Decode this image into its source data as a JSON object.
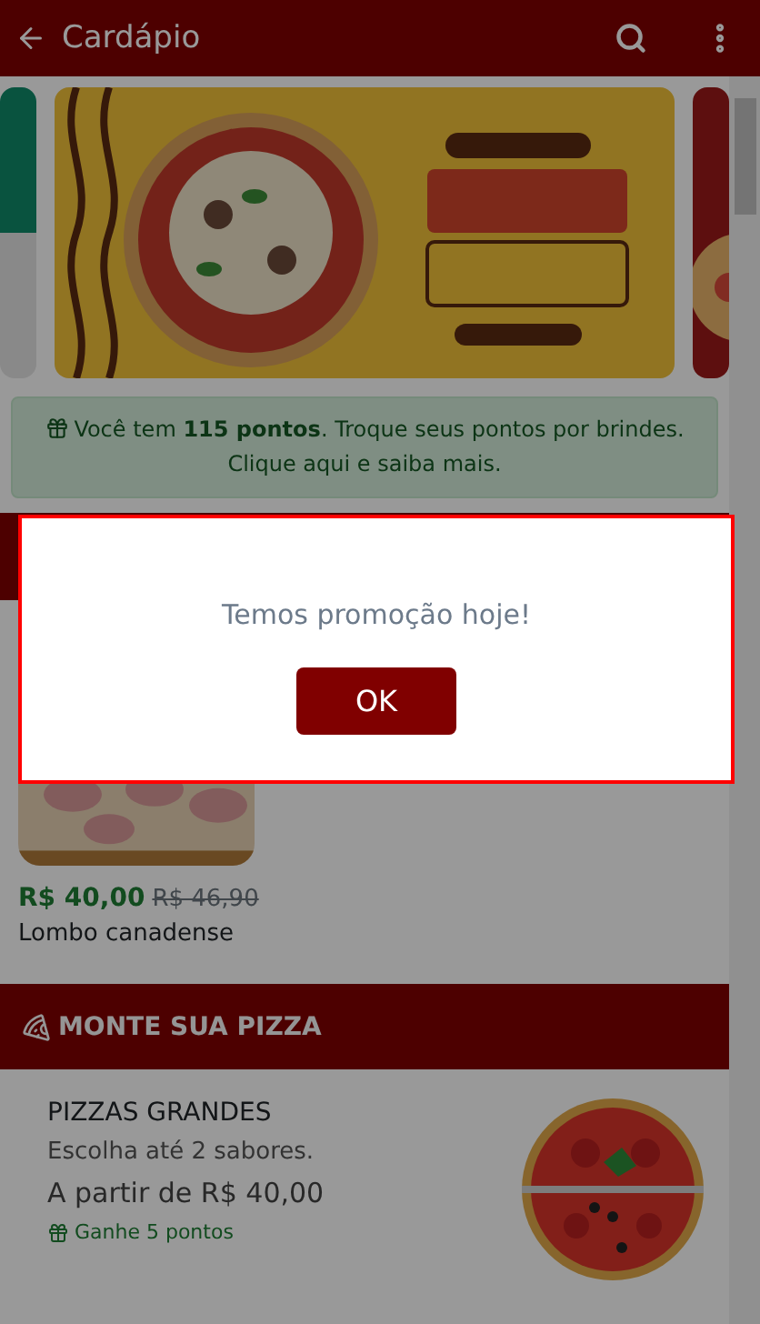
{
  "header": {
    "title": "Cardápio"
  },
  "points_notice": {
    "text": "Você tem **115 pontos**. Troque seus pontos por brindes. Clique aqui e saiba mais."
  },
  "products": [
    {
      "price": "R$ 40,00",
      "old_price": "R$ 46,90",
      "name": "Lombo canadense"
    }
  ],
  "build_section": {
    "title": "MONTE SUA PIZZA",
    "item": {
      "title": "PIZZAS GRANDES",
      "description": "Escolha até 2 sabores.",
      "price": "A partir de R$ 40,00",
      "points": "Ganhe 5 pontos"
    }
  },
  "dialog": {
    "message": "Temos promoção hoje!",
    "button": "OK"
  }
}
